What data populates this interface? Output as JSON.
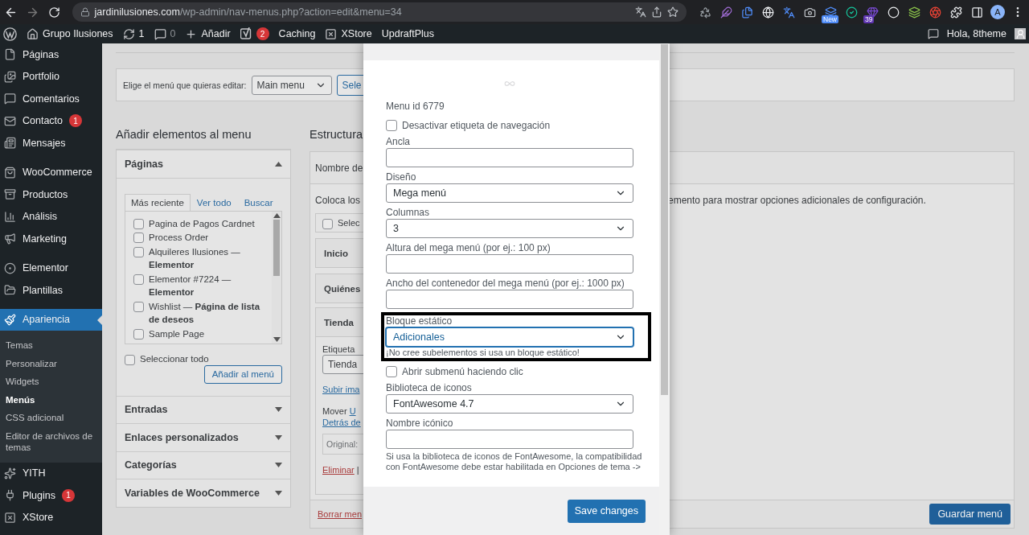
{
  "browser": {
    "host": "jardinilusiones.com",
    "path": "/wp-admin/nav-menus.php?action=edit&menu=34",
    "extensions": [
      {
        "kind": "recycle"
      },
      {
        "kind": "feather"
      },
      {
        "kind": "files"
      },
      {
        "kind": "globe"
      },
      {
        "kind": "translate"
      },
      {
        "kind": "camera"
      },
      {
        "kind": "new",
        "badge": "New"
      },
      {
        "kind": "grammar"
      },
      {
        "kind": "gem",
        "badge": "39"
      },
      {
        "kind": "s-circle"
      },
      {
        "kind": "layers"
      },
      {
        "kind": "aperture"
      },
      {
        "kind": "puzzle"
      },
      {
        "kind": "panel"
      }
    ],
    "profile": "A"
  },
  "admin_bar": {
    "items": [
      {
        "kind": "wp"
      },
      {
        "kind": "home",
        "label": "Grupo Ilusiones"
      },
      {
        "kind": "updates",
        "label": "1"
      },
      {
        "kind": "comments",
        "label": "0"
      },
      {
        "kind": "new",
        "label": "Añadir"
      },
      {
        "kind": "yoast",
        "badge": "2"
      },
      {
        "kind": "plain",
        "label": "Caching"
      },
      {
        "kind": "xstore",
        "label": "XStore"
      },
      {
        "kind": "plain",
        "label": "UpdraftPlus"
      }
    ],
    "greeting": "Hola, 8theme"
  },
  "sidebar": {
    "items": [
      {
        "kind": "pages",
        "label": "Páginas",
        "selected": false
      },
      {
        "kind": "portfolio",
        "label": "Portfolio",
        "selected": false
      },
      {
        "kind": "comments",
        "label": "Comentarios",
        "selected": false
      },
      {
        "kind": "mail",
        "label": "Contacto",
        "badge": "1",
        "selected": false
      },
      {
        "kind": "messages",
        "label": "Mensajes",
        "selected": false
      },
      {
        "kind": "woo",
        "label": "WooCommerce",
        "selected": false,
        "separator_before": true
      },
      {
        "kind": "products",
        "label": "Productos",
        "selected": false
      },
      {
        "kind": "analytics",
        "label": "Análisis",
        "selected": false
      },
      {
        "kind": "marketing",
        "label": "Marketing",
        "selected": false
      },
      {
        "kind": "elementor",
        "label": "Elementor",
        "selected": false,
        "separator_before": true
      },
      {
        "kind": "templates",
        "label": "Plantillas",
        "selected": false
      },
      {
        "kind": "appearance",
        "label": "Apariencia",
        "selected": true,
        "separator_before": true,
        "children": [
          {
            "label": "Temas",
            "selected": false
          },
          {
            "label": "Personalizar",
            "selected": false
          },
          {
            "label": "Widgets",
            "selected": false
          },
          {
            "label": "Menús",
            "selected": true
          },
          {
            "label": "CSS adicional",
            "selected": false
          },
          {
            "label": "Editor de archivos de temas",
            "selected": false
          }
        ]
      },
      {
        "kind": "yith",
        "label": "YITH",
        "selected": false
      },
      {
        "kind": "plugins",
        "label": "Plugins",
        "badge": "1",
        "selected": false
      },
      {
        "kind": "xstore",
        "label": "XStore",
        "selected": false
      }
    ]
  },
  "menu_picker": {
    "label": "Elige el menú que quieras editar:",
    "value": "Main menu",
    "button": "Sele"
  },
  "add_items": {
    "title": "Añadir elementos al menu",
    "sections": [
      {
        "title": "Páginas",
        "expanded": true,
        "tabs": [
          {
            "label": "Más reciente",
            "selected": true
          },
          {
            "label": "Ver todo",
            "selected": false
          },
          {
            "label": "Buscar",
            "selected": false
          }
        ],
        "pages": [
          {
            "label": "Pagina de Pagos Cardnet",
            "checked": false
          },
          {
            "label": "Process Order",
            "checked": false
          },
          {
            "label": "Alquileres Ilusiones — **Elementor**",
            "checked": false
          },
          {
            "label": "Elementor #7224 — **Elementor**",
            "checked": false
          },
          {
            "label": "Wishlist — **Página de lista de deseos**",
            "checked": false
          },
          {
            "label": "Sample Page",
            "checked": false
          }
        ],
        "select_all": {
          "label": "Seleccionar todo",
          "checked": false
        },
        "add_button": "Añadir al menú"
      },
      {
        "title": "Entradas",
        "expanded": false
      },
      {
        "title": "Enlaces personalizados",
        "expanded": false
      },
      {
        "title": "Categorías",
        "expanded": false
      },
      {
        "title": "Variables de WooCommerce",
        "expanded": false
      }
    ]
  },
  "structure": {
    "title": "Estructura",
    "name_label": "Nombre de",
    "hint": "Coloca los",
    "hint_tail": "emento para mostrar opciones adicionales de configuración.",
    "bulk_select": {
      "label": "Selec",
      "checked": false
    },
    "items": [
      {
        "title": "Inicio",
        "expanded": false
      },
      {
        "title": "Quiénes",
        "expanded": false
      },
      {
        "title": "Tienda",
        "expanded": true,
        "label_text": "Etiqueta",
        "value": "Tienda",
        "upload_link": "Subir ima",
        "move_label": "Mover",
        "move_link": "U",
        "move_link_2": "Detrás de",
        "original": "Original:",
        "remove_link": "Eliminar",
        "separator": "|"
      }
    ],
    "delete_link": "Borrar men",
    "save_button": "Guardar menú"
  },
  "modal": {
    "menu_id": "Menu id 6779",
    "fields": [
      {
        "kind": "checkbox",
        "label": "Desactivar etiqueta de navegación",
        "checked": false
      },
      {
        "kind": "text",
        "label": "Ancla"
      },
      {
        "kind": "select",
        "label": "Diseño",
        "value": "Mega menú"
      },
      {
        "kind": "select",
        "label": "Columnas",
        "value": "3"
      },
      {
        "kind": "text",
        "label": "Altura del mega menú (por ej.: 100 px)"
      },
      {
        "kind": "text",
        "label": "Ancho del contenedor del mega menú (por ej.: 1000 px)"
      },
      {
        "kind": "select",
        "label": "Bloque estático",
        "value": "Adicionales",
        "focused": true,
        "highlighted": true,
        "note": "¡No cree subelementos si usa un bloque estático!"
      },
      {
        "kind": "checkbox",
        "label": "Abrir submenú haciendo clic",
        "checked": false
      },
      {
        "kind": "select",
        "label": "Biblioteca de iconos",
        "value": "FontAwesome 4.7"
      },
      {
        "kind": "text",
        "label": "Nombre icónico",
        "note": "Si usa la biblioteca de iconos de FontAwesome, la compatibilidad con FontAwesome debe estar habilitada en Opciones de tema ->"
      }
    ],
    "save_button": "Save changes"
  }
}
